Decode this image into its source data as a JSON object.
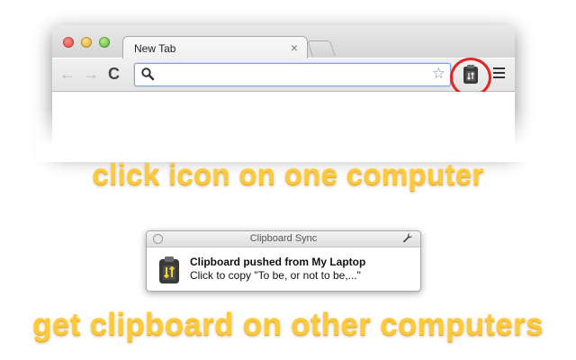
{
  "browser": {
    "tab_title": "New Tab",
    "tab_close": "×",
    "nav_back": "←",
    "nav_forward": "→",
    "nav_reload": "C",
    "address_value": "",
    "star": "☆",
    "icons": [
      "back-arrow-icon",
      "forward-arrow-icon",
      "reload-icon",
      "search-icon",
      "star-icon",
      "clipboard-sync-extension-icon",
      "hamburger-menu-icon"
    ]
  },
  "captions": {
    "step1": "click icon on one computer",
    "step2": "get clipboard on other computers"
  },
  "notification": {
    "app_title": "Clipboard Sync",
    "headline": "Clipboard pushed from My Laptop",
    "body": "Click to copy \"To be, or not to be,...\""
  },
  "colors": {
    "caption": "#ffc93c",
    "highlight_ring": "#e32525",
    "omnibox_border": "#7ea3d8"
  }
}
